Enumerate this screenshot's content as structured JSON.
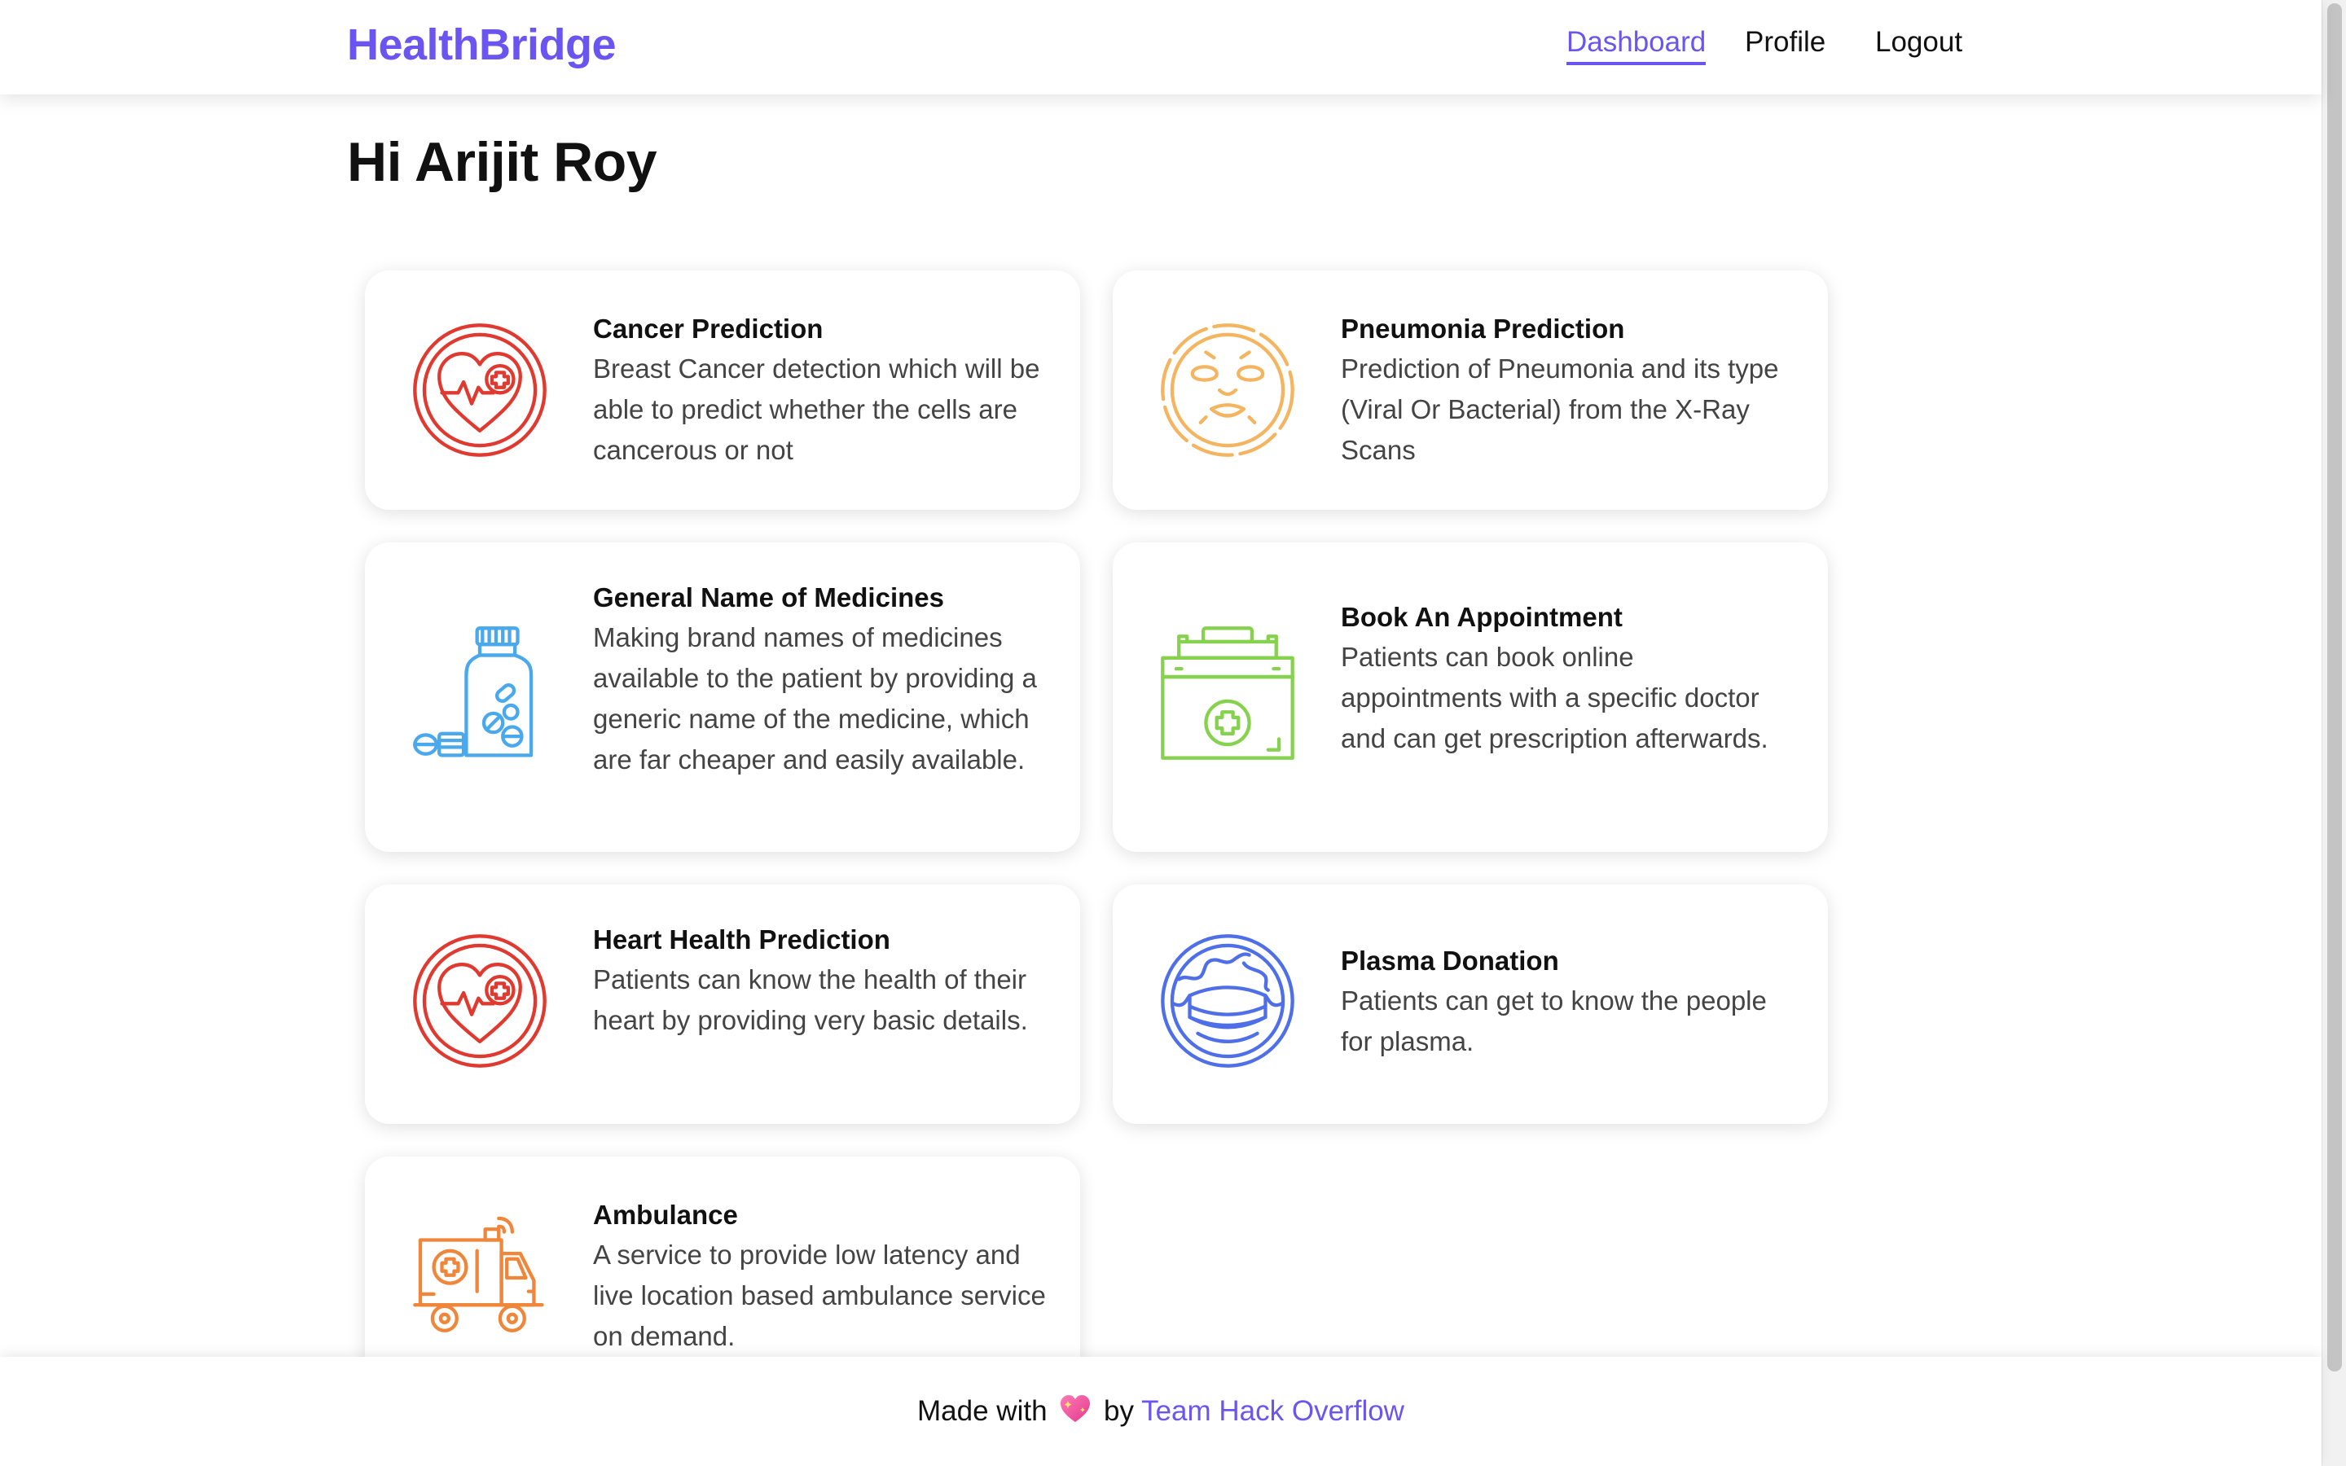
{
  "header": {
    "brand": "HealthBridge",
    "nav": {
      "dashboard": "Dashboard",
      "profile": "Profile",
      "logout": "Logout"
    }
  },
  "greeting": "Hi Arijit Roy",
  "cards": {
    "cancer": {
      "title": "Cancer Prediction",
      "desc": "Breast Cancer detection which will be able to predict whether the cells are cancerous or not",
      "icon": "heart-medical-icon",
      "color": "#e0392f"
    },
    "pneumonia": {
      "title": "Pneumonia Prediction",
      "desc": "Prediction of Pneumonia and its type (Viral Or Bacterial) from the X-Ray Scans",
      "icon": "face-mask-icon",
      "color": "#f4b560"
    },
    "generic": {
      "title": "General Name of Medicines",
      "desc": "Making brand names of medicines available to the patient by providing a generic name of the medicine, which are far cheaper and easily available.",
      "icon": "pill-bottle-icon",
      "color": "#4aa8ec"
    },
    "appointment": {
      "title": "Book An Appointment",
      "desc": "Patients can book online appointments with a specific doctor and can get prescription afterwards.",
      "icon": "first-aid-kit-icon",
      "color": "#86d24f"
    },
    "heart": {
      "title": "Heart Health Prediction",
      "desc": "Patients can know the health of their heart by providing very basic details.",
      "icon": "heart-medical-icon",
      "color": "#e0392f"
    },
    "plasma": {
      "title": "Plasma Donation",
      "desc": "Patients can get to know the people for plasma.",
      "icon": "globe-mask-icon",
      "color": "#4f6fe8"
    },
    "ambulance": {
      "title": "Ambulance",
      "desc": "A service to provide low latency and live location based ambulance service on demand.",
      "icon": "ambulance-icon",
      "color": "#f0863a"
    }
  },
  "footer": {
    "made_with": "Made with",
    "heart_icon": "sparkling-heart-icon",
    "by": "by",
    "team": "Team Hack Overflow"
  },
  "colors": {
    "accent": "#6a55f0"
  }
}
